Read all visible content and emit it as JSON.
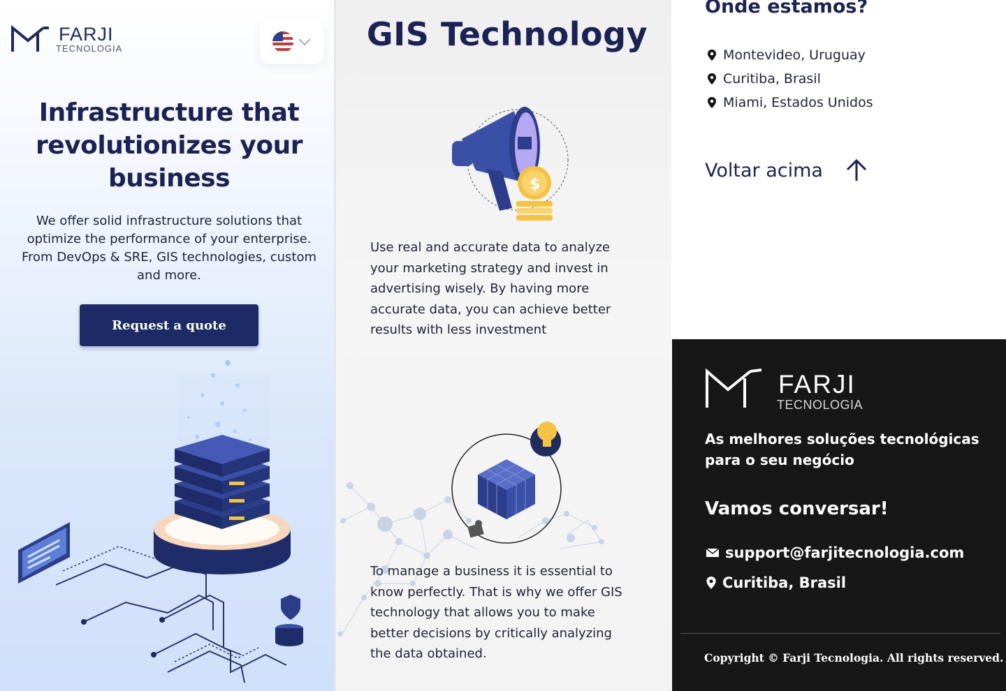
{
  "header": {
    "logo_name": "FARJI",
    "logo_sub": "TECNOLOGIA",
    "language_flag": "us-flag-icon"
  },
  "hero": {
    "title": "Infrastructure that revolutionizes your business",
    "description": "We offer solid infrastructure solutions that optimize the performance of your enterprise. From DevOps & SRE, GIS technologies, custom and more.",
    "cta_label": "Request a quote"
  },
  "gis": {
    "title": "GIS Technology",
    "block1": "Use real and accurate data to analyze your marketing strategy and invest in advertising wisely. By having more accurate data, you can achieve better results with less investment",
    "block2": "To manage a business it is essential to know perfectly. That is why we offer GIS technology that allows you to make better decisions by critically analyzing the data obtained."
  },
  "locations": {
    "title": "Onde estamos?",
    "items": [
      "Montevideo, Uruguay",
      "Curitiba, Brasil",
      "Miami, Estados Unidos"
    ],
    "back_to_top": "Voltar acima"
  },
  "footer": {
    "logo_name": "FARJI",
    "logo_sub": "TECNOLOGIA",
    "tagline": "As melhores soluções tecnológicas para o seu negócio",
    "cta_title": "Vamos conversar!",
    "email": "support@farjitecnologia.com",
    "address": "Curitiba, Brasil",
    "copyright": "Copyright © Farji Tecnologia. All rights reserved."
  },
  "colors": {
    "navy": "#1a2353",
    "button": "#1c2a66",
    "footer_bg": "#171717",
    "accent_gold": "#f5c342"
  }
}
